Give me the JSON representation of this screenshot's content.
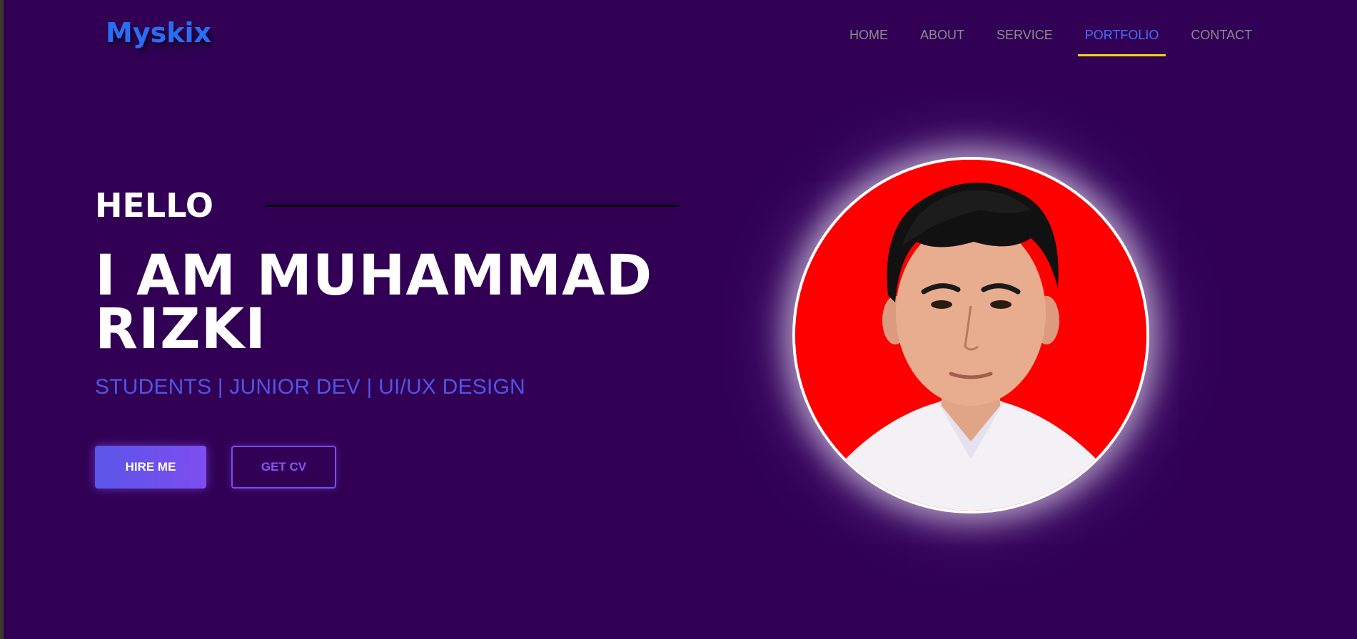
{
  "header": {
    "logo": "Myskix",
    "nav": [
      {
        "label": "HOME",
        "active": false
      },
      {
        "label": "ABOUT",
        "active": false
      },
      {
        "label": "SERVICE",
        "active": false
      },
      {
        "label": "PORTFOLIO",
        "active": true
      },
      {
        "label": "CONTACT",
        "active": false
      }
    ]
  },
  "hero": {
    "greeting": "HELLO",
    "name_line1": "I AM MUHAMMAD",
    "name_line2": "RIZKI",
    "subtitle": "STUDENTS | JUNIOR DEV | UI/UX DESIGN",
    "hire_label": "HIRE ME",
    "cv_label": "GET CV"
  },
  "colors": {
    "background": "#310055",
    "logo": "#2a6df5",
    "accent": "#4a6cf7",
    "underline": "#f2d40f",
    "subtitle": "#5055e6",
    "photo_bg": "#ff0000"
  },
  "portrait": {
    "alt": "profile-photo"
  }
}
